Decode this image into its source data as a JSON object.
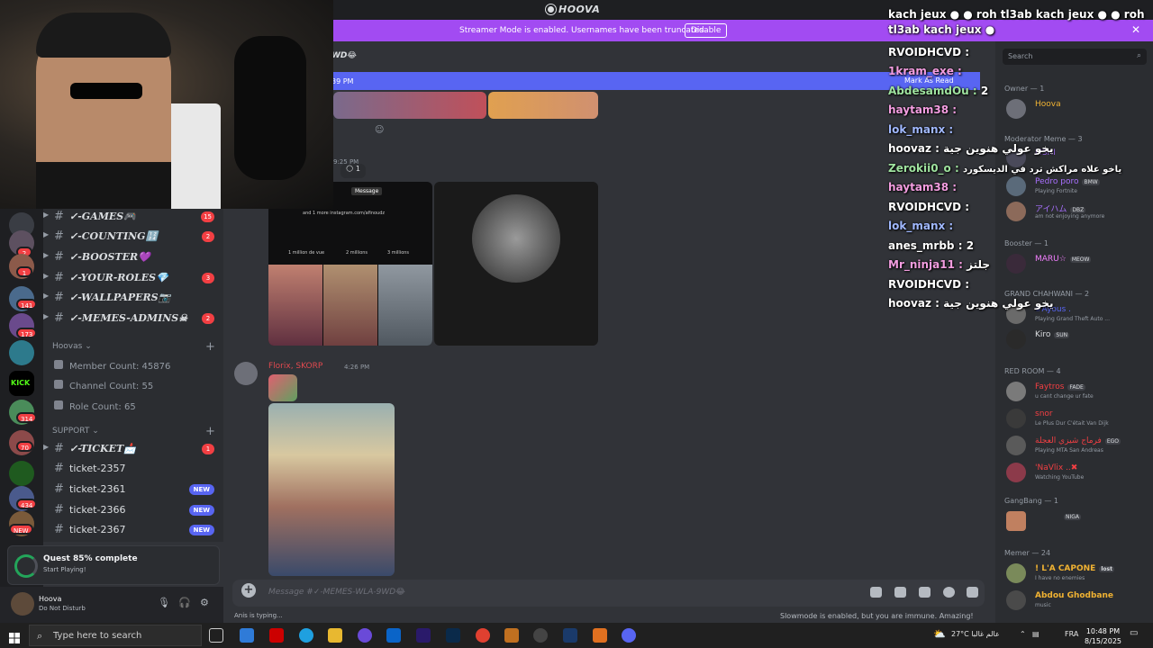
{
  "titlebar": {
    "title": "HOOVA"
  },
  "banner": {
    "text": "Streamer Mode is enabled. Usernames have been truncated.",
    "disable_label": "Disable",
    "close": "✕"
  },
  "rail": {
    "badges": [
      "2",
      "1",
      "141",
      "173",
      "314",
      "70",
      "434",
      "NEW"
    ]
  },
  "sidebar": {
    "channels_top": [
      {
        "name": "✓-GAMES🎮",
        "count": "15"
      },
      {
        "name": "✓-COUNTING🔢",
        "count": "2"
      },
      {
        "name": "✓-BOOSTER💜",
        "count": ""
      },
      {
        "name": "✓-YOUR-ROLES💎",
        "count": "3"
      },
      {
        "name": "✓-WALLPAPERS📷",
        "count": ""
      },
      {
        "name": "✓-MEMES-ADMINS☠",
        "count": "2"
      }
    ],
    "category_hoovas": "Hoovas",
    "stats": [
      "Member Count: 45876",
      "Channel Count: 55",
      "Role Count: 65"
    ],
    "category_support": "SUPPORT",
    "support_channels": [
      {
        "name": "✓-TICKET📩",
        "count": "1",
        "new": ""
      },
      {
        "name": "ticket-2357",
        "count": "",
        "new": ""
      },
      {
        "name": "ticket-2361",
        "count": "",
        "new": "NEW"
      },
      {
        "name": "ticket-2366",
        "count": "",
        "new": "NEW"
      },
      {
        "name": "ticket-2367",
        "count": "",
        "new": "NEW"
      }
    ]
  },
  "quest": {
    "title": "Quest 85% complete",
    "subtitle": "Start Playing!",
    "progress": 0.85
  },
  "user": {
    "name": "Hoova",
    "status": "Do Not Disturb"
  },
  "chat": {
    "channel_header": "WD😂",
    "new_messages": "39 PM",
    "mark_as_read": "Mark As Read",
    "reaction_count": "1",
    "timestamp_1": "9:25 PM",
    "timestamp_2": "4:26 PM",
    "author": "Florix, SKORP",
    "profile_card": {
      "message_button": "Message",
      "link_text": "and 1 more instagram.com/afinoudz",
      "stats": [
        "1 million de vue",
        "2 millions",
        "3 millions"
      ]
    },
    "input_placeholder": "Message #✓-MEMES-WLA-9WD😂",
    "typing": "Anis is typing...",
    "slowmode": "Slowmode is enabled, but you are immune. Amazing!"
  },
  "members": {
    "search_placeholder": "Search",
    "groups": [
      {
        "title": "Owner — 1",
        "members": [
          {
            "name": "Hoova",
            "status": "",
            "color": "#f0b232",
            "tag": ""
          }
        ]
      },
      {
        "title": "Moderator Meme — 3",
        "members": [
          {
            "name": "FISHI",
            "status": "",
            "color": "#a970ff",
            "tag": ""
          },
          {
            "name": "Pedro poro",
            "status": "Playing Fortnite",
            "color": "#a970ff",
            "tag": "BMW"
          },
          {
            "name": "アイハム",
            "status": "am not enjoying anymore",
            "color": "#a970ff",
            "tag": "DBZ"
          }
        ]
      },
      {
        "title": "Booster — 1",
        "members": [
          {
            "name": "MARU☆",
            "status": "",
            "color": "#f47fff",
            "tag": "MEOW"
          }
        ]
      },
      {
        "title": "GRAND CHAHWANI — 2",
        "members": [
          {
            "name": "#Ayous .",
            "status": "Playing Grand Theft Auto ...",
            "color": "#5865f2",
            "tag": ""
          },
          {
            "name": "Kiro",
            "status": "",
            "color": "#dbdee1",
            "tag": "SUN"
          }
        ]
      },
      {
        "title": "RED ROOM — 4",
        "members": [
          {
            "name": "Faytros",
            "status": "u cant change ur fate",
            "color": "#f23f43",
            "tag": "FADE"
          },
          {
            "name": "snor",
            "status": "Le Plus Dur C'était Van Dijk",
            "color": "#f23f43",
            "tag": ""
          },
          {
            "name": "فرماج شيزي العجلة",
            "status": "Playing MTA San Andreas",
            "color": "#f23f43",
            "tag": "EGO"
          },
          {
            "name": "'NaVlix ..✖",
            "status": "Watching YouTube",
            "color": "#f23f43",
            "tag": ""
          }
        ]
      },
      {
        "title": "GangBang — 1",
        "members": [
          {
            "name": "",
            "status": "",
            "color": "#f0b232",
            "tag": "NIGA"
          }
        ]
      },
      {
        "title": "Memer — 24",
        "members": [
          {
            "name": "! L'A CAPONE",
            "status": "I have no enemies",
            "color": "#f0b232",
            "tag": "lost"
          },
          {
            "name": "Abdou Ghodbane",
            "status": "music",
            "color": "#f0b232",
            "tag": ""
          }
        ]
      }
    ]
  },
  "overlay": {
    "header": "kach jeux ● ● roh tl3ab kach jeux ● ● roh tl3ab kach jeux ●",
    "lines": [
      {
        "user": "RVOIDHCVD :",
        "text": "",
        "cls": "white"
      },
      {
        "user": "1kram_exe :",
        "text": "",
        "cls": "pink"
      },
      {
        "user": "AbdesamdOu :",
        "text": "2",
        "cls": "green"
      },
      {
        "user": "haytam38 :",
        "text": "",
        "cls": "white"
      },
      {
        "user": "lok_manx :",
        "text": "",
        "cls": "white"
      },
      {
        "user": "hoovaz :",
        "text": "يخو عولي هنوين جية",
        "cls": "white"
      },
      {
        "user": "Zerokii0_o :",
        "text": "ياخو علاه مراكش ترد في الديسكورد",
        "cls": "green"
      },
      {
        "user": "haytam38 :",
        "text": "",
        "cls": "white"
      },
      {
        "user": "RVOIDHCVD :",
        "text": "",
        "cls": "white"
      },
      {
        "user": "lok_manx :",
        "text": "",
        "cls": "white"
      },
      {
        "user": "anes_mrbb :",
        "text": "2",
        "cls": "white"
      },
      {
        "user": "Mr_ninja11 :",
        "text": "جلتز",
        "cls": "green"
      },
      {
        "user": "RVOIDHCVD :",
        "text": "",
        "cls": "white"
      },
      {
        "user": "hoovaz :",
        "text": "يخو عولي هنوين جية",
        "cls": "white"
      }
    ]
  },
  "taskbar": {
    "search_placeholder": "Type here to search",
    "weather": "27°C عالم غالبا",
    "lang": "FRA",
    "time": "10:48 PM",
    "date": "8/15/2025"
  },
  "colors": {
    "accent": "#5865f2",
    "banner": "#a24bf2",
    "danger": "#f23f43"
  }
}
